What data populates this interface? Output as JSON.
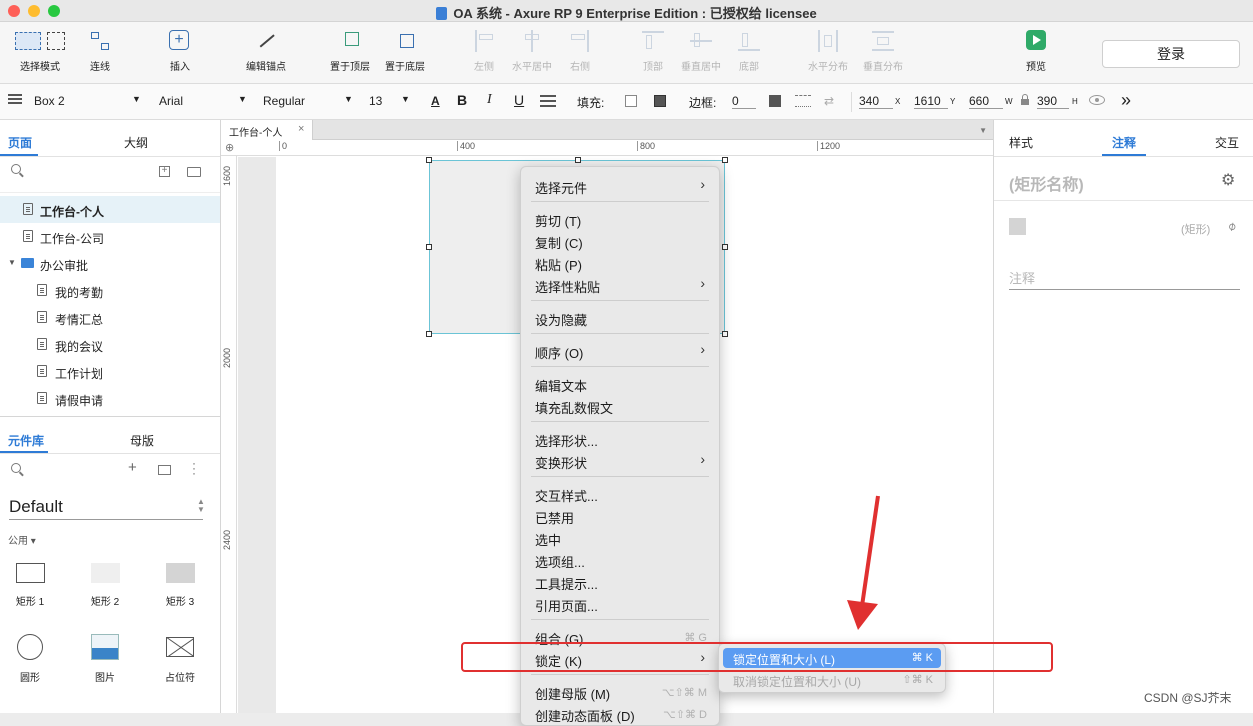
{
  "window": {
    "title": "OA 系统 - Axure RP 9 Enterprise Edition : 已授权给 licensee"
  },
  "toolbar": {
    "items": [
      "选择模式",
      "连线",
      "插入",
      "编辑锚点",
      "置于顶层",
      "置于底层",
      "左侧",
      "水平居中",
      "右侧",
      "顶部",
      "垂直居中",
      "底部",
      "水平分布",
      "垂直分布",
      "预览"
    ],
    "login": "登录"
  },
  "format": {
    "element_name": "Box 2",
    "font": "Arial",
    "weight": "Regular",
    "size": "13",
    "fill_label": "填充:",
    "border_label": "边框:",
    "border_value": "0",
    "x": "340",
    "x_label": "X",
    "y": "1610",
    "y_label": "Y",
    "w": "660",
    "w_label": "W",
    "h": "390",
    "h_label": "H"
  },
  "left": {
    "tabs": [
      "页面",
      "大纲"
    ],
    "pages": [
      "工作台-个人",
      "工作台-公司",
      "办公审批",
      "我的考勤",
      "考情汇总",
      "我的会议",
      "工作计划",
      "请假申请"
    ],
    "lib_tabs": [
      "元件库",
      "母版"
    ],
    "library": "Default",
    "category": "公用 ▾",
    "widgets": [
      "矩形 1",
      "矩形 2",
      "矩形 3",
      "圆形",
      "图片",
      "占位符"
    ]
  },
  "canvas": {
    "tab": "工作台-个人",
    "ruler_h": [
      "0",
      "400",
      "800",
      "1200"
    ],
    "ruler_v": [
      "1600",
      "2000",
      "2400"
    ]
  },
  "right": {
    "tabs": [
      "样式",
      "注释",
      "交互"
    ],
    "shape_name": "(矩形名称)",
    "shape_type": "(矩形)",
    "notes_label": "注释"
  },
  "menu": {
    "items": [
      "选择元件",
      "剪切 (T)",
      "复制 (C)",
      "粘贴 (P)",
      "选择性粘贴",
      "设为隐藏",
      "顺序 (O)",
      "编辑文本",
      "填充乱数假文",
      "选择形状...",
      "变换形状",
      "交互样式...",
      "已禁用",
      "选中",
      "选项组...",
      "工具提示...",
      "引用页面...",
      "组合 (G)",
      "锁定 (K)",
      "创建母版 (M)",
      "创建动态面板 (D)"
    ],
    "shortcuts": {
      "group": "⌘ G",
      "master": "⌥⇧⌘ M",
      "panel": "⌥⇧⌘ D"
    }
  },
  "submenu": {
    "items": [
      "锁定位置和大小 (L)",
      "取消锁定位置和大小 (U)"
    ],
    "shortcuts": [
      "⌘ K",
      "⇧⌘ K"
    ]
  },
  "watermark": "CSDN @SJ芥末",
  "colors": {
    "accent": "#2e7bd6",
    "highlight": "#5b9cf2",
    "red": "#e03030"
  }
}
